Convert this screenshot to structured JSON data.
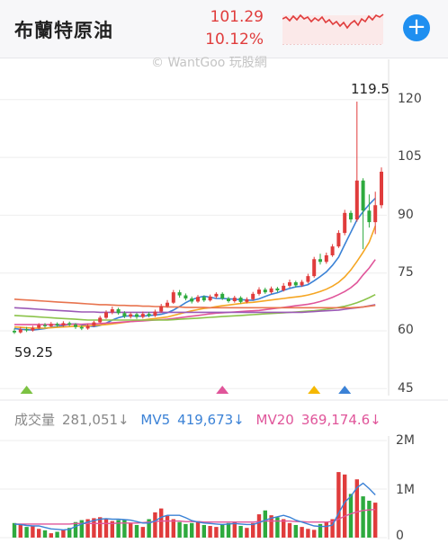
{
  "header": {
    "title": "布蘭特原油",
    "price": "101.29",
    "change_pct": "10.12%",
    "add_icon": "plus-icon",
    "accent": "#1f8ff0",
    "up_color": "#e03c3c"
  },
  "watermark": "© WantGoo 玩股網",
  "price_chart": {
    "high_label": "119.5",
    "low_label": "59.25",
    "y_ticks": [
      "120",
      "105",
      "90",
      "75",
      "60",
      "45"
    ]
  },
  "volume": {
    "label": "成交量",
    "value": "281,051↓",
    "mv5_label": "MV5",
    "mv5_value": "419,673↓",
    "mv20_label": "MV20",
    "mv20_value": "369,174.6↓",
    "y_ticks": [
      "2M",
      "1M",
      "0"
    ],
    "colors": {
      "label": "#888888",
      "mv5": "#3b82d6",
      "mv20": "#e0559a"
    }
  },
  "chart_data": {
    "type": "candlestick",
    "ylim": [
      45,
      125
    ],
    "candles": [
      {
        "o": 60,
        "c": 59.6,
        "h": 60.6,
        "l": 59.2
      },
      {
        "o": 59.6,
        "c": 60.4,
        "h": 61,
        "l": 59.3
      },
      {
        "o": 60.4,
        "c": 60.1,
        "h": 61,
        "l": 59.7
      },
      {
        "o": 60.1,
        "c": 60.8,
        "h": 61.3,
        "l": 59.8
      },
      {
        "o": 60.8,
        "c": 61.5,
        "h": 62,
        "l": 60.4
      },
      {
        "o": 61.5,
        "c": 61.2,
        "h": 62,
        "l": 60.8
      },
      {
        "o": 61.2,
        "c": 61.8,
        "h": 62.3,
        "l": 60.9
      },
      {
        "o": 61.8,
        "c": 61.4,
        "h": 62.2,
        "l": 61
      },
      {
        "o": 61.4,
        "c": 62,
        "h": 62.5,
        "l": 61
      },
      {
        "o": 62,
        "c": 61.6,
        "h": 62.4,
        "l": 61.2
      },
      {
        "o": 61.6,
        "c": 61,
        "h": 62,
        "l": 60.5
      },
      {
        "o": 61,
        "c": 60.6,
        "h": 61.4,
        "l": 60.2
      },
      {
        "o": 60.6,
        "c": 61.3,
        "h": 61.8,
        "l": 60.3
      },
      {
        "o": 61.3,
        "c": 62.2,
        "h": 62.6,
        "l": 61
      },
      {
        "o": 62.2,
        "c": 63.4,
        "h": 63.9,
        "l": 62
      },
      {
        "o": 63.4,
        "c": 64.8,
        "h": 65.3,
        "l": 63.1
      },
      {
        "o": 64.8,
        "c": 65.6,
        "h": 66.3,
        "l": 64.3
      },
      {
        "o": 65.6,
        "c": 64.6,
        "h": 66,
        "l": 64.2
      },
      {
        "o": 64.6,
        "c": 63.7,
        "h": 65.1,
        "l": 63.3
      },
      {
        "o": 63.7,
        "c": 64.3,
        "h": 64.8,
        "l": 63.2
      },
      {
        "o": 64.3,
        "c": 63.6,
        "h": 64.7,
        "l": 63.1
      },
      {
        "o": 63.6,
        "c": 64.4,
        "h": 65,
        "l": 63.2
      },
      {
        "o": 64.4,
        "c": 63.9,
        "h": 64.9,
        "l": 63.5
      },
      {
        "o": 63.9,
        "c": 65,
        "h": 65.5,
        "l": 63.6
      },
      {
        "o": 65,
        "c": 66.4,
        "h": 67,
        "l": 64.7
      },
      {
        "o": 66.4,
        "c": 67.3,
        "h": 68,
        "l": 66
      },
      {
        "o": 67.3,
        "c": 70,
        "h": 70.6,
        "l": 67
      },
      {
        "o": 70,
        "c": 69.2,
        "h": 70.6,
        "l": 68.6
      },
      {
        "o": 69.2,
        "c": 68.4,
        "h": 69.7,
        "l": 67.9
      },
      {
        "o": 68.4,
        "c": 67.6,
        "h": 68.9,
        "l": 67.1
      },
      {
        "o": 67.6,
        "c": 68.8,
        "h": 69.3,
        "l": 67.3
      },
      {
        "o": 68.8,
        "c": 67.9,
        "h": 69.2,
        "l": 67.5
      },
      {
        "o": 67.9,
        "c": 68.9,
        "h": 69.4,
        "l": 67.6
      },
      {
        "o": 68.9,
        "c": 69.6,
        "h": 70,
        "l": 68.4
      },
      {
        "o": 69.6,
        "c": 68.4,
        "h": 70,
        "l": 68
      },
      {
        "o": 68.4,
        "c": 67.7,
        "h": 68.8,
        "l": 67.3
      },
      {
        "o": 67.7,
        "c": 68.6,
        "h": 69.1,
        "l": 67.3
      },
      {
        "o": 68.6,
        "c": 67.5,
        "h": 69,
        "l": 67.1
      },
      {
        "o": 67.5,
        "c": 68.2,
        "h": 68.7,
        "l": 67.1
      },
      {
        "o": 68.2,
        "c": 69.6,
        "h": 70.1,
        "l": 67.9
      },
      {
        "o": 69.6,
        "c": 70.7,
        "h": 71.3,
        "l": 69.2
      },
      {
        "o": 70.7,
        "c": 70,
        "h": 71.2,
        "l": 69.6
      },
      {
        "o": 70,
        "c": 71,
        "h": 71.5,
        "l": 69.6
      },
      {
        "o": 71,
        "c": 70.5,
        "h": 71.4,
        "l": 70
      },
      {
        "o": 70.5,
        "c": 71.7,
        "h": 72.4,
        "l": 70.2
      },
      {
        "o": 71.7,
        "c": 72.6,
        "h": 73.3,
        "l": 71.2
      },
      {
        "o": 72.6,
        "c": 71.8,
        "h": 73,
        "l": 71.3
      },
      {
        "o": 71.8,
        "c": 72.7,
        "h": 73.2,
        "l": 71.4
      },
      {
        "o": 72.7,
        "c": 74.2,
        "h": 74.8,
        "l": 72.3
      },
      {
        "o": 74.2,
        "c": 78.6,
        "h": 79.2,
        "l": 73.8
      },
      {
        "o": 78.6,
        "c": 77.9,
        "h": 80,
        "l": 77.2
      },
      {
        "o": 77.9,
        "c": 79.6,
        "h": 80.3,
        "l": 77.4
      },
      {
        "o": 79.6,
        "c": 81.9,
        "h": 82.5,
        "l": 79.2
      },
      {
        "o": 81.9,
        "c": 85.4,
        "h": 86.1,
        "l": 81.5
      },
      {
        "o": 85.4,
        "c": 90.6,
        "h": 91.4,
        "l": 84.8
      },
      {
        "o": 90.6,
        "c": 88.9,
        "h": 91.2,
        "l": 88.1
      },
      {
        "o": 88.9,
        "c": 99,
        "h": 119.5,
        "l": 88.3
      },
      {
        "o": 99,
        "c": 91.2,
        "h": 99.6,
        "l": 81.2
      },
      {
        "o": 91.2,
        "c": 88.2,
        "h": 95.4,
        "l": 86.8
      },
      {
        "o": 88.2,
        "c": 92.6,
        "h": 96.1,
        "l": 85.1
      },
      {
        "o": 92.6,
        "c": 101.29,
        "h": 102.4,
        "l": 91.8
      }
    ],
    "ma_series": [
      {
        "color": "#3b82d6",
        "values": [
          60.6,
          60.4,
          60.3,
          60.2,
          60.4,
          60.6,
          60.9,
          61.1,
          61.4,
          61.7,
          61.8,
          61.6,
          61.3,
          61.1,
          61.4,
          62,
          62.8,
          63.4,
          63.8,
          63.9,
          63.8,
          63.8,
          64,
          64.1,
          64.3,
          64.7,
          65.4,
          66.3,
          67.3,
          68.1,
          68.6,
          69,
          68.7,
          68.4,
          68.4,
          68.3,
          68.2,
          68.1,
          68,
          67.9,
          68.3,
          68.9,
          69.5,
          69.9,
          70.5,
          71,
          71.4,
          71.6,
          72,
          73,
          74.1,
          75.3,
          77,
          79.1,
          82.4,
          85.6,
          88.8,
          90.9,
          92.8,
          94.4
        ]
      },
      {
        "color": "#f5a623",
        "values": [
          61,
          60.9,
          60.8,
          60.7,
          60.7,
          60.7,
          60.8,
          60.9,
          61,
          61.1,
          61.2,
          61.2,
          61.3,
          61.4,
          61.5,
          61.6,
          61.8,
          62,
          62.2,
          62.4,
          62.6,
          62.8,
          63,
          63.2,
          63.4,
          63.6,
          64,
          64.4,
          64.8,
          65.2,
          65.5,
          65.8,
          66,
          66.3,
          66.5,
          66.7,
          66.9,
          67.1,
          67.3,
          67.4,
          67.6,
          67.8,
          68,
          68.2,
          68.4,
          68.6,
          68.8,
          69,
          69.3,
          69.7,
          70.2,
          70.8,
          71.6,
          72.6,
          74,
          75.8,
          78,
          80.4,
          83,
          87.2
        ]
      },
      {
        "color": "#e0559a",
        "values": [
          61.6,
          61.6,
          61.6,
          61.6,
          61.6,
          61.6,
          61.6,
          61.6,
          61.6,
          61.7,
          61.7,
          61.7,
          61.8,
          61.8,
          61.9,
          62,
          62.1,
          62.2,
          62.3,
          62.4,
          62.5,
          62.6,
          62.7,
          62.8,
          62.9,
          63,
          63.2,
          63.4,
          63.6,
          63.8,
          64,
          64.2,
          64.4,
          64.6,
          64.7,
          64.8,
          64.9,
          65,
          65.1,
          65.2,
          65.3,
          65.5,
          65.7,
          65.9,
          66.1,
          66.3,
          66.5,
          66.7,
          66.9,
          67.2,
          67.6,
          68.1,
          68.7,
          69.4,
          70.2,
          71.2,
          72.5,
          74.5,
          76.3,
          78.5
        ]
      },
      {
        "color": "#8bc34a",
        "values": [
          64,
          63.9,
          63.8,
          63.7,
          63.6,
          63.5,
          63.4,
          63.3,
          63.2,
          63.1,
          63,
          62.9,
          62.8,
          62.8,
          62.8,
          62.8,
          62.8,
          62.8,
          62.8,
          62.8,
          62.8,
          62.8,
          62.8,
          62.8,
          62.8,
          62.8,
          62.9,
          63,
          63.1,
          63.2,
          63.3,
          63.4,
          63.5,
          63.6,
          63.7,
          63.8,
          63.9,
          64,
          64.1,
          64.2,
          64.3,
          64.4,
          64.5,
          64.6,
          64.7,
          64.8,
          64.9,
          65,
          65.1,
          65.2,
          65.4,
          65.6,
          65.8,
          66.1,
          66.4,
          66.8,
          67.3,
          67.9,
          68.6,
          69.4
        ]
      },
      {
        "color": "#9b59b6",
        "values": [
          66,
          65.9,
          65.8,
          65.7,
          65.6,
          65.5,
          65.4,
          65.3,
          65.2,
          65.1,
          65,
          64.9,
          64.9,
          64.9,
          64.8,
          64.8,
          64.8,
          64.8,
          64.8,
          64.8,
          64.8,
          64.8,
          64.8,
          64.8,
          64.8,
          64.8,
          64.8,
          64.8,
          64.8,
          64.8,
          64.8,
          64.8,
          64.8,
          64.8,
          64.8,
          64.8,
          64.8,
          64.8,
          64.8,
          64.8,
          64.8,
          64.8,
          64.8,
          64.8,
          64.8,
          64.8,
          64.8,
          64.8,
          64.9,
          65,
          65.1,
          65.2,
          65.3,
          65.4,
          65.6,
          65.8,
          66,
          66.2,
          66.5,
          66.8
        ]
      },
      {
        "color": "#e8744f",
        "values": [
          68.2,
          68.1,
          68,
          67.9,
          67.8,
          67.7,
          67.6,
          67.5,
          67.4,
          67.3,
          67.2,
          67.1,
          67,
          66.9,
          66.8,
          66.8,
          66.7,
          66.6,
          66.6,
          66.5,
          66.5,
          66.4,
          66.4,
          66.3,
          66.3,
          66.2,
          66.2,
          66.2,
          66.1,
          66.1,
          66.1,
          66.1,
          66,
          66,
          66,
          66,
          66,
          66,
          66,
          66,
          66,
          66,
          66,
          66,
          66,
          66,
          66,
          66,
          66,
          66,
          66,
          66,
          66,
          66,
          66,
          66,
          66.1,
          66.2,
          66.4,
          66.6
        ]
      }
    ],
    "markers": [
      {
        "index": 2,
        "color": "#7cc242"
      },
      {
        "index": 34,
        "color": "#e0559a"
      },
      {
        "index": 49,
        "color": "#f5b800"
      },
      {
        "index": 54,
        "color": "#3b82d6"
      }
    ],
    "volume_series": {
      "ylim": [
        0,
        2000000
      ],
      "values": [
        300000,
        260000,
        220000,
        240000,
        180000,
        150000,
        90000,
        120000,
        160000,
        200000,
        320000,
        360000,
        380000,
        400000,
        420000,
        380000,
        340000,
        360000,
        360000,
        300000,
        260000,
        220000,
        380000,
        520000,
        600000,
        450000,
        380000,
        320000,
        280000,
        300000,
        340000,
        260000,
        240000,
        220000,
        280000,
        300000,
        320000,
        240000,
        200000,
        300000,
        480000,
        560000,
        460000,
        420000,
        380000,
        300000,
        260000,
        220000,
        180000,
        160000,
        280000,
        320000,
        380000,
        1350000,
        1300000,
        900000,
        1200000,
        850000,
        760000,
        720000
      ],
      "up": [
        false,
        true,
        false,
        true,
        true,
        false,
        true,
        false,
        true,
        false,
        false,
        false,
        true,
        true,
        true,
        true,
        true,
        false,
        false,
        true,
        false,
        true,
        false,
        true,
        true,
        true,
        true,
        false,
        false,
        false,
        true,
        false,
        true,
        true,
        false,
        false,
        true,
        false,
        true,
        true,
        true,
        false,
        true,
        false,
        true,
        true,
        false,
        true,
        true,
        true,
        false,
        true,
        true,
        true,
        true,
        false,
        true,
        false,
        false,
        true
      ],
      "mv5": [
        280000,
        270000,
        250000,
        240000,
        240000,
        210000,
        180000,
        170000,
        160000,
        170000,
        230000,
        280000,
        320000,
        350000,
        380000,
        390000,
        380000,
        380000,
        370000,
        360000,
        330000,
        300000,
        300000,
        340000,
        420000,
        460000,
        460000,
        460000,
        410000,
        350000,
        320000,
        300000,
        290000,
        280000,
        270000,
        280000,
        290000,
        280000,
        270000,
        270000,
        310000,
        360000,
        400000,
        430000,
        460000,
        420000,
        360000,
        320000,
        280000,
        240000,
        230000,
        230000,
        260000,
        500000,
        730000,
        850000,
        1030000,
        1120000,
        1010000,
        880000
      ],
      "mv20": [
        280000,
        280000,
        280000,
        280000,
        280000,
        280000,
        280000,
        280000,
        280000,
        280000,
        290000,
        290000,
        290000,
        290000,
        290000,
        290000,
        290000,
        300000,
        300000,
        300000,
        300000,
        310000,
        320000,
        330000,
        340000,
        340000,
        340000,
        340000,
        330000,
        330000,
        330000,
        320000,
        320000,
        320000,
        320000,
        320000,
        320000,
        320000,
        320000,
        320000,
        330000,
        340000,
        340000,
        340000,
        340000,
        340000,
        330000,
        330000,
        320000,
        320000,
        320000,
        320000,
        330000,
        380000,
        440000,
        490000,
        530000,
        560000,
        570000,
        580000
      ]
    }
  }
}
